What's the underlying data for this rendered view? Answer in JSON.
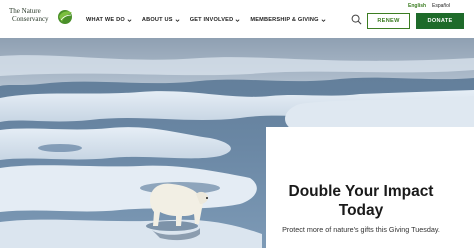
{
  "brand": {
    "name_line1": "The Nature",
    "name_line2": "Conservancy",
    "logo_icon": "leaf-globe-icon",
    "accent_color": "#3c7d22"
  },
  "language": {
    "english": "English",
    "spanish": "Español"
  },
  "nav": {
    "items": [
      {
        "label": "WHAT WE DO"
      },
      {
        "label": "ABOUT US"
      },
      {
        "label": "GET INVOLVED"
      },
      {
        "label": "MEMBERSHIP & GIVING"
      }
    ]
  },
  "actions": {
    "renew_label": "RENEW",
    "donate_label": "DONATE",
    "donate_color": "#1e6b2a"
  },
  "hero": {
    "image_subject": "polar bear on sea ice"
  },
  "promo": {
    "title_line1": "Double Your Impact",
    "title_line2": "Today",
    "subtitle": "Protect more of nature's gifts this Giving Tuesday."
  }
}
